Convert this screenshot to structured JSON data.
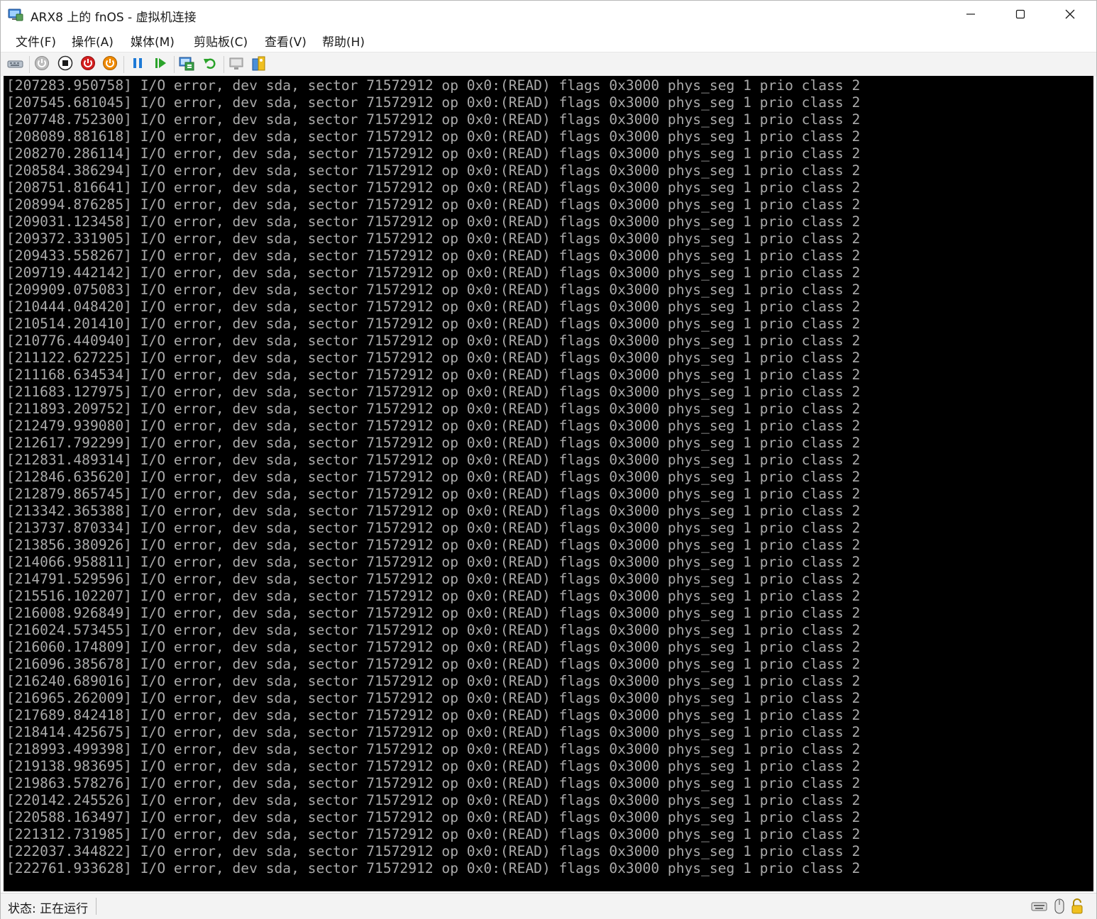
{
  "window": {
    "title": "ARX8 上的 fnOS - 虚拟机连接",
    "icons": {
      "app": "vm-connect-icon",
      "minimize": "minimize-icon",
      "maximize": "maximize-icon",
      "close": "close-icon"
    }
  },
  "menu": {
    "items": [
      "文件(F)",
      "操作(A)",
      "媒体(M)",
      "剪贴板(C)",
      "查看(V)",
      "帮助(H)"
    ]
  },
  "toolbar": {
    "buttons": [
      {
        "name": "ctrl-alt-del-icon"
      },
      {
        "name": "start-icon"
      },
      {
        "name": "turn-off-icon"
      },
      {
        "name": "shut-down-icon"
      },
      {
        "name": "save-icon"
      },
      {
        "name": "pause-icon"
      },
      {
        "name": "resume-icon"
      },
      {
        "name": "checkpoint-icon"
      },
      {
        "name": "revert-icon"
      },
      {
        "name": "enhanced-session-icon"
      },
      {
        "name": "share-icon"
      }
    ],
    "colors": {
      "red": "#d41e1e",
      "orange": "#f08a00",
      "blue": "#1e7ad6",
      "green": "#2aa32a",
      "gray": "#9a9a9a"
    }
  },
  "console": {
    "text_color": "#aaaaaa",
    "background": "#000000",
    "lines": [
      "[207283.950758] I/O error, dev sda, sector 71572912 op 0x0:(READ) flags 0x3000 phys_seg 1 prio class 2",
      "[207545.681045] I/O error, dev sda, sector 71572912 op 0x0:(READ) flags 0x3000 phys_seg 1 prio class 2",
      "[207748.752300] I/O error, dev sda, sector 71572912 op 0x0:(READ) flags 0x3000 phys_seg 1 prio class 2",
      "[208089.881618] I/O error, dev sda, sector 71572912 op 0x0:(READ) flags 0x3000 phys_seg 1 prio class 2",
      "[208270.286114] I/O error, dev sda, sector 71572912 op 0x0:(READ) flags 0x3000 phys_seg 1 prio class 2",
      "[208584.386294] I/O error, dev sda, sector 71572912 op 0x0:(READ) flags 0x3000 phys_seg 1 prio class 2",
      "[208751.816641] I/O error, dev sda, sector 71572912 op 0x0:(READ) flags 0x3000 phys_seg 1 prio class 2",
      "[208994.876285] I/O error, dev sda, sector 71572912 op 0x0:(READ) flags 0x3000 phys_seg 1 prio class 2",
      "[209031.123458] I/O error, dev sda, sector 71572912 op 0x0:(READ) flags 0x3000 phys_seg 1 prio class 2",
      "[209372.331905] I/O error, dev sda, sector 71572912 op 0x0:(READ) flags 0x3000 phys_seg 1 prio class 2",
      "[209433.558267] I/O error, dev sda, sector 71572912 op 0x0:(READ) flags 0x3000 phys_seg 1 prio class 2",
      "[209719.442142] I/O error, dev sda, sector 71572912 op 0x0:(READ) flags 0x3000 phys_seg 1 prio class 2",
      "[209909.075083] I/O error, dev sda, sector 71572912 op 0x0:(READ) flags 0x3000 phys_seg 1 prio class 2",
      "[210444.048420] I/O error, dev sda, sector 71572912 op 0x0:(READ) flags 0x3000 phys_seg 1 prio class 2",
      "[210514.201410] I/O error, dev sda, sector 71572912 op 0x0:(READ) flags 0x3000 phys_seg 1 prio class 2",
      "[210776.440940] I/O error, dev sda, sector 71572912 op 0x0:(READ) flags 0x3000 phys_seg 1 prio class 2",
      "[211122.627225] I/O error, dev sda, sector 71572912 op 0x0:(READ) flags 0x3000 phys_seg 1 prio class 2",
      "[211168.634534] I/O error, dev sda, sector 71572912 op 0x0:(READ) flags 0x3000 phys_seg 1 prio class 2",
      "[211683.127975] I/O error, dev sda, sector 71572912 op 0x0:(READ) flags 0x3000 phys_seg 1 prio class 2",
      "[211893.209752] I/O error, dev sda, sector 71572912 op 0x0:(READ) flags 0x3000 phys_seg 1 prio class 2",
      "[212479.939080] I/O error, dev sda, sector 71572912 op 0x0:(READ) flags 0x3000 phys_seg 1 prio class 2",
      "[212617.792299] I/O error, dev sda, sector 71572912 op 0x0:(READ) flags 0x3000 phys_seg 1 prio class 2",
      "[212831.489314] I/O error, dev sda, sector 71572912 op 0x0:(READ) flags 0x3000 phys_seg 1 prio class 2",
      "[212846.635620] I/O error, dev sda, sector 71572912 op 0x0:(READ) flags 0x3000 phys_seg 1 prio class 2",
      "[212879.865745] I/O error, dev sda, sector 71572912 op 0x0:(READ) flags 0x3000 phys_seg 1 prio class 2",
      "[213342.365388] I/O error, dev sda, sector 71572912 op 0x0:(READ) flags 0x3000 phys_seg 1 prio class 2",
      "[213737.870334] I/O error, dev sda, sector 71572912 op 0x0:(READ) flags 0x3000 phys_seg 1 prio class 2",
      "[213856.380926] I/O error, dev sda, sector 71572912 op 0x0:(READ) flags 0x3000 phys_seg 1 prio class 2",
      "[214066.958811] I/O error, dev sda, sector 71572912 op 0x0:(READ) flags 0x3000 phys_seg 1 prio class 2",
      "[214791.529596] I/O error, dev sda, sector 71572912 op 0x0:(READ) flags 0x3000 phys_seg 1 prio class 2",
      "[215516.102207] I/O error, dev sda, sector 71572912 op 0x0:(READ) flags 0x3000 phys_seg 1 prio class 2",
      "[216008.926849] I/O error, dev sda, sector 71572912 op 0x0:(READ) flags 0x3000 phys_seg 1 prio class 2",
      "[216024.573455] I/O error, dev sda, sector 71572912 op 0x0:(READ) flags 0x3000 phys_seg 1 prio class 2",
      "[216060.174809] I/O error, dev sda, sector 71572912 op 0x0:(READ) flags 0x3000 phys_seg 1 prio class 2",
      "[216096.385678] I/O error, dev sda, sector 71572912 op 0x0:(READ) flags 0x3000 phys_seg 1 prio class 2",
      "[216240.689016] I/O error, dev sda, sector 71572912 op 0x0:(READ) flags 0x3000 phys_seg 1 prio class 2",
      "[216965.262009] I/O error, dev sda, sector 71572912 op 0x0:(READ) flags 0x3000 phys_seg 1 prio class 2",
      "[217689.842418] I/O error, dev sda, sector 71572912 op 0x0:(READ) flags 0x3000 phys_seg 1 prio class 2",
      "[218414.425675] I/O error, dev sda, sector 71572912 op 0x0:(READ) flags 0x3000 phys_seg 1 prio class 2",
      "[218993.499398] I/O error, dev sda, sector 71572912 op 0x0:(READ) flags 0x3000 phys_seg 1 prio class 2",
      "[219138.983695] I/O error, dev sda, sector 71572912 op 0x0:(READ) flags 0x3000 phys_seg 1 prio class 2",
      "[219863.578276] I/O error, dev sda, sector 71572912 op 0x0:(READ) flags 0x3000 phys_seg 1 prio class 2",
      "[220142.245526] I/O error, dev sda, sector 71572912 op 0x0:(READ) flags 0x3000 phys_seg 1 prio class 2",
      "[220588.163497] I/O error, dev sda, sector 71572912 op 0x0:(READ) flags 0x3000 phys_seg 1 prio class 2",
      "[221312.731985] I/O error, dev sda, sector 71572912 op 0x0:(READ) flags 0x3000 phys_seg 1 prio class 2",
      "[222037.344822] I/O error, dev sda, sector 71572912 op 0x0:(READ) flags 0x3000 phys_seg 1 prio class 2",
      "[222761.933628] I/O error, dev sda, sector 71572912 op 0x0:(READ) flags 0x3000 phys_seg 1 prio class 2"
    ]
  },
  "status": {
    "text": "状态: 正在运行",
    "icons": [
      "keyboard-icon",
      "mouse-icon",
      "lock-icon"
    ]
  }
}
